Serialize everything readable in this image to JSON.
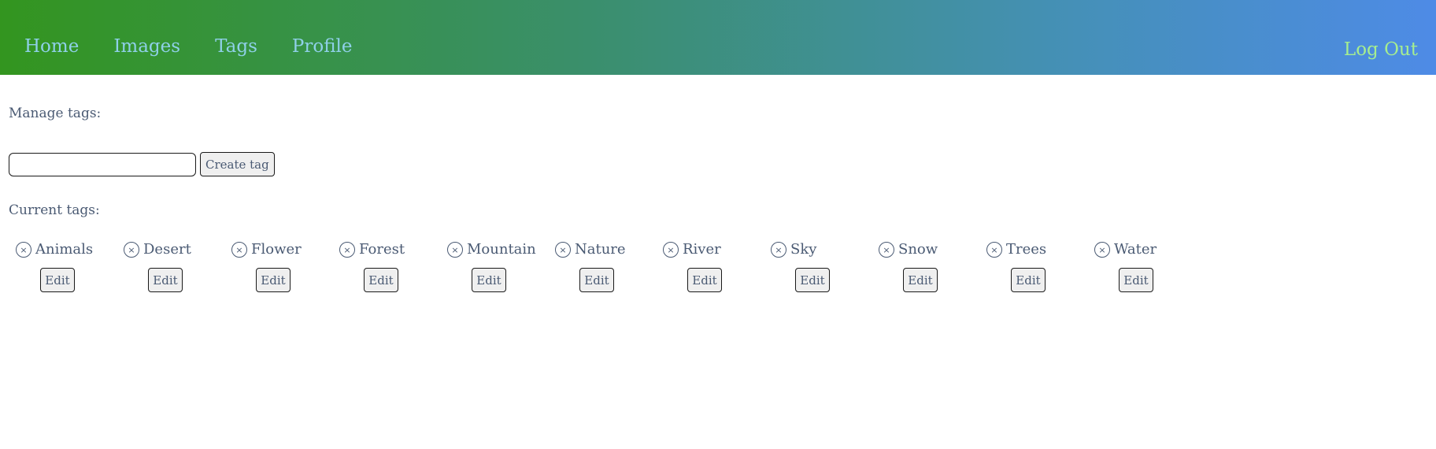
{
  "nav": {
    "links": [
      "Home",
      "Images",
      "Tags",
      "Profile"
    ],
    "logout": "Log Out"
  },
  "manage": {
    "label": "Manage tags:",
    "input_value": "",
    "create_label": "Create tag"
  },
  "current": {
    "label": "Current tags:",
    "edit_label": "Edit",
    "remove_glyph": "×",
    "tags": [
      "Animals",
      "Desert",
      "Flower",
      "Forest",
      "Mountain",
      "Nature",
      "River",
      "Sky",
      "Snow",
      "Trees",
      "Water"
    ]
  },
  "colors": {
    "gradient_start": "#33951f",
    "gradient_end": "#4e8be6",
    "nav_link": "#8fd0e8",
    "logout": "#a6ee8f",
    "text": "#4a5a73"
  }
}
